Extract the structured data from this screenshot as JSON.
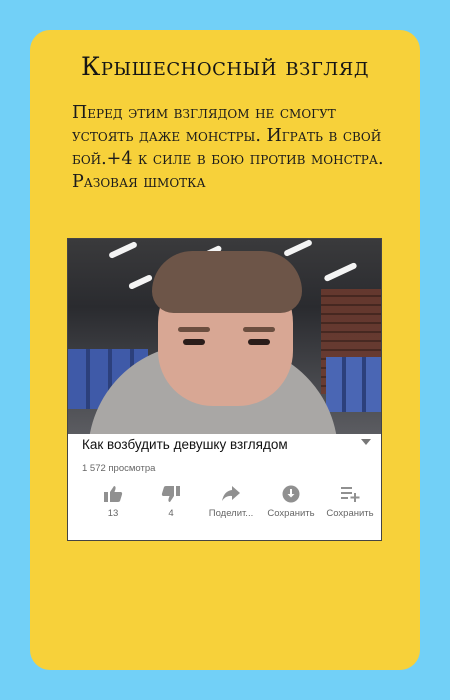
{
  "card": {
    "title": "Крышесносный взгляд",
    "description": "Перед этим взглядом не смогут устоять даже монстры. Играть в свой бой.+4 к силе в бою против монстра. Разовая шмотка"
  },
  "video": {
    "title": "Как возбудить девушку взглядом",
    "views": "1 572 просмотра",
    "actions": [
      {
        "icon": "thumbs-up-icon",
        "label": "13"
      },
      {
        "icon": "thumbs-down-icon",
        "label": "4"
      },
      {
        "icon": "share-icon",
        "label": "Поделит..."
      },
      {
        "icon": "download-icon",
        "label": "Сохранить"
      },
      {
        "icon": "playlist-add-icon",
        "label": "Сохранить"
      }
    ]
  },
  "colors": {
    "background": "#72d0f7",
    "card": "#f7d13a"
  }
}
